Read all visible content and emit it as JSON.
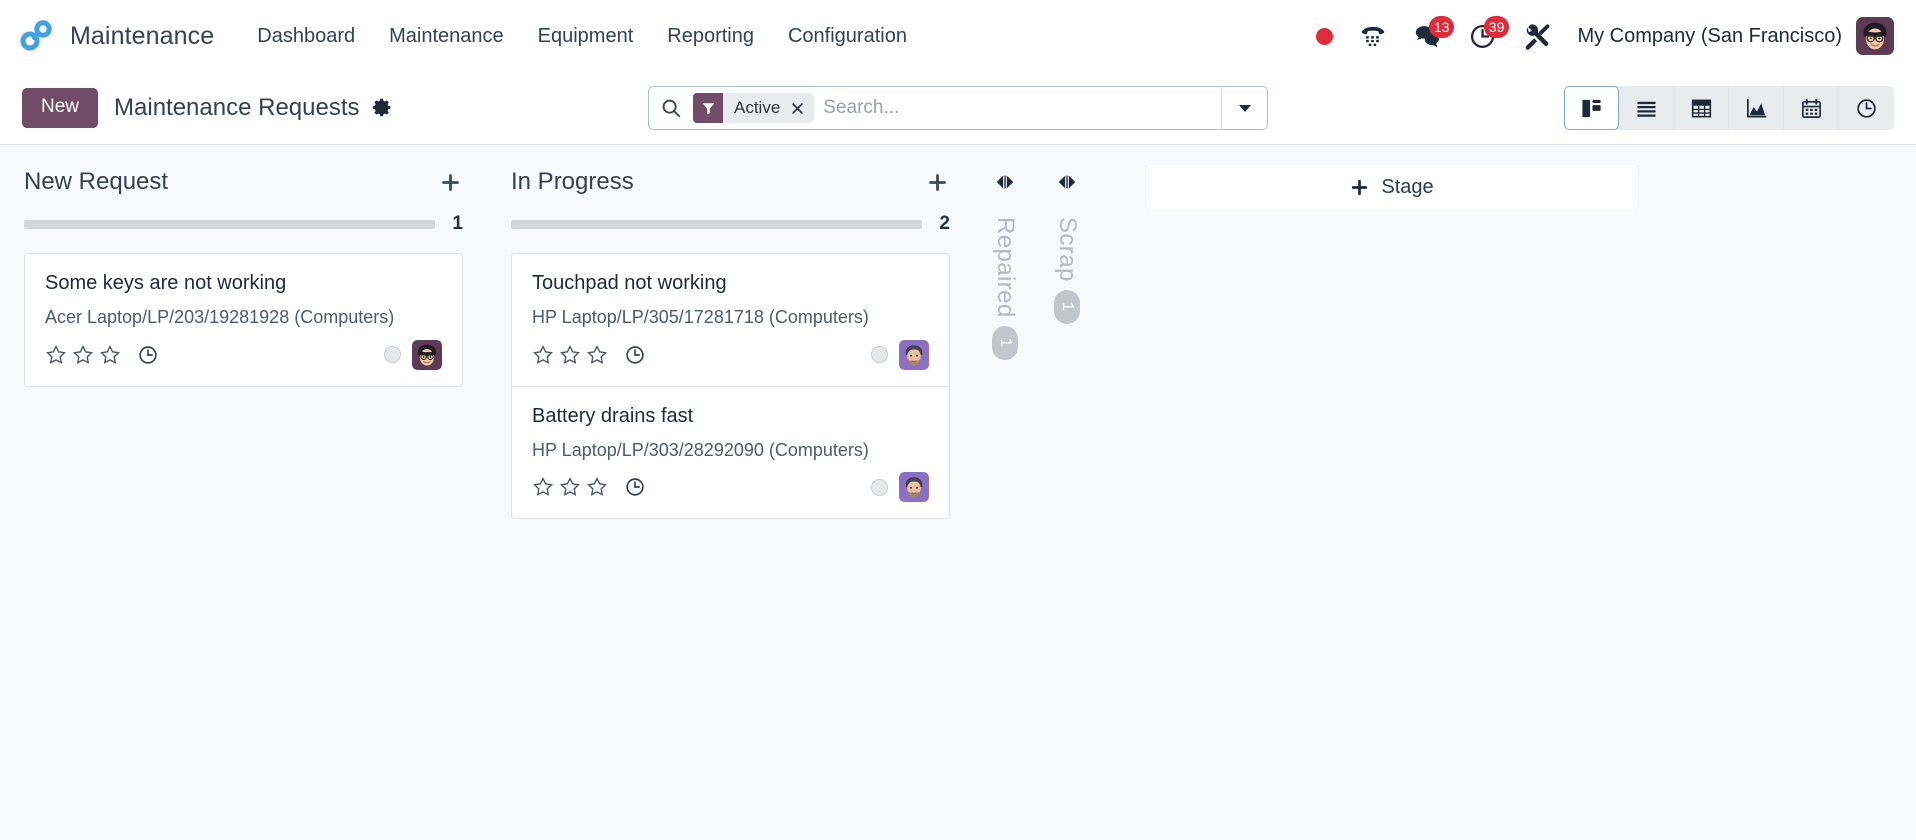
{
  "navbar": {
    "brand": "Maintenance",
    "logo_icon": "odoo-chain-logo-icon",
    "menu": [
      {
        "label": "Dashboard",
        "name": "menu-dashboard"
      },
      {
        "label": "Maintenance",
        "name": "menu-maintenance"
      },
      {
        "label": "Equipment",
        "name": "menu-equipment"
      },
      {
        "label": "Reporting",
        "name": "menu-reporting"
      },
      {
        "label": "Configuration",
        "name": "menu-configuration"
      }
    ],
    "systray": {
      "recording_icon": "record-dot-icon",
      "voip_icon": "phone-keypad-icon",
      "messages_icon": "chat-bubbles-icon",
      "messages_count": "13",
      "activities_icon": "clock-activity-icon",
      "activities_count": "39",
      "tools_icon": "wrench-screwdriver-icon",
      "company": "My Company (San Francisco)",
      "avatar_icon": "user-avatar-icon"
    }
  },
  "control_panel": {
    "new_label": "New",
    "title": "Maintenance Requests",
    "settings_icon": "gear-icon",
    "search": {
      "search_icon": "magnifier-icon",
      "facet_icon": "filter-funnel-icon",
      "facet_label": "Active",
      "facet_remove_icon": "close-x-icon",
      "placeholder": "Search...",
      "value": "",
      "dropdown_icon": "caret-down-icon"
    },
    "views": [
      {
        "name": "view-kanban",
        "icon": "kanban-icon",
        "active": true
      },
      {
        "name": "view-list",
        "icon": "list-icon",
        "active": false
      },
      {
        "name": "view-pivot",
        "icon": "pivot-table-icon",
        "active": false
      },
      {
        "name": "view-graph",
        "icon": "area-chart-icon",
        "active": false
      },
      {
        "name": "view-calendar",
        "icon": "calendar-icon",
        "active": false
      },
      {
        "name": "view-activity",
        "icon": "clock-icon",
        "active": false
      }
    ]
  },
  "kanban": {
    "add_stage_label": "Stage",
    "add_stage_icon": "plus-icon",
    "columns": [
      {
        "title": "New Request",
        "count": "1",
        "folded": false,
        "add_icon": "plus-icon",
        "cards": [
          {
            "title": "Some keys are not working",
            "subtitle": "Acer Laptop/LP/203/19281928 (Computers)",
            "priority_stars": 0,
            "total_stars": 3,
            "activity_icon": "clock-icon",
            "status_dot": "kanban-activity-dot",
            "avatar_icon": "assignee-avatar-mitchell-admin",
            "avatar_style": "dark"
          }
        ]
      },
      {
        "title": "In Progress",
        "count": "2",
        "folded": false,
        "add_icon": "plus-icon",
        "cards": [
          {
            "title": "Touchpad not working",
            "subtitle": "HP Laptop/LP/305/17281718 (Computers)",
            "priority_stars": 0,
            "total_stars": 3,
            "activity_icon": "clock-icon",
            "status_dot": "kanban-activity-dot",
            "avatar_icon": "assignee-avatar-beard",
            "avatar_style": "light"
          },
          {
            "title": "Battery drains fast",
            "subtitle": "HP Laptop/LP/303/28292090 (Computers)",
            "priority_stars": 0,
            "total_stars": 3,
            "activity_icon": "clock-icon",
            "status_dot": "kanban-activity-dot",
            "avatar_icon": "assignee-avatar-beard",
            "avatar_style": "light"
          }
        ]
      },
      {
        "title": "Repaired",
        "count": "1",
        "folded": true,
        "unfold_icon": "expand-horizontal-icon",
        "cards": []
      },
      {
        "title": "Scrap",
        "count": "1",
        "folded": true,
        "unfold_icon": "expand-horizontal-icon",
        "cards": []
      }
    ]
  },
  "colors": {
    "brand_purple": "#714B67",
    "badge_red": "#E02C3A",
    "logo_blue": "#3FA2E8",
    "kanban_bg": "#F8F9FB",
    "progress_gray": "#D4D7DC"
  }
}
